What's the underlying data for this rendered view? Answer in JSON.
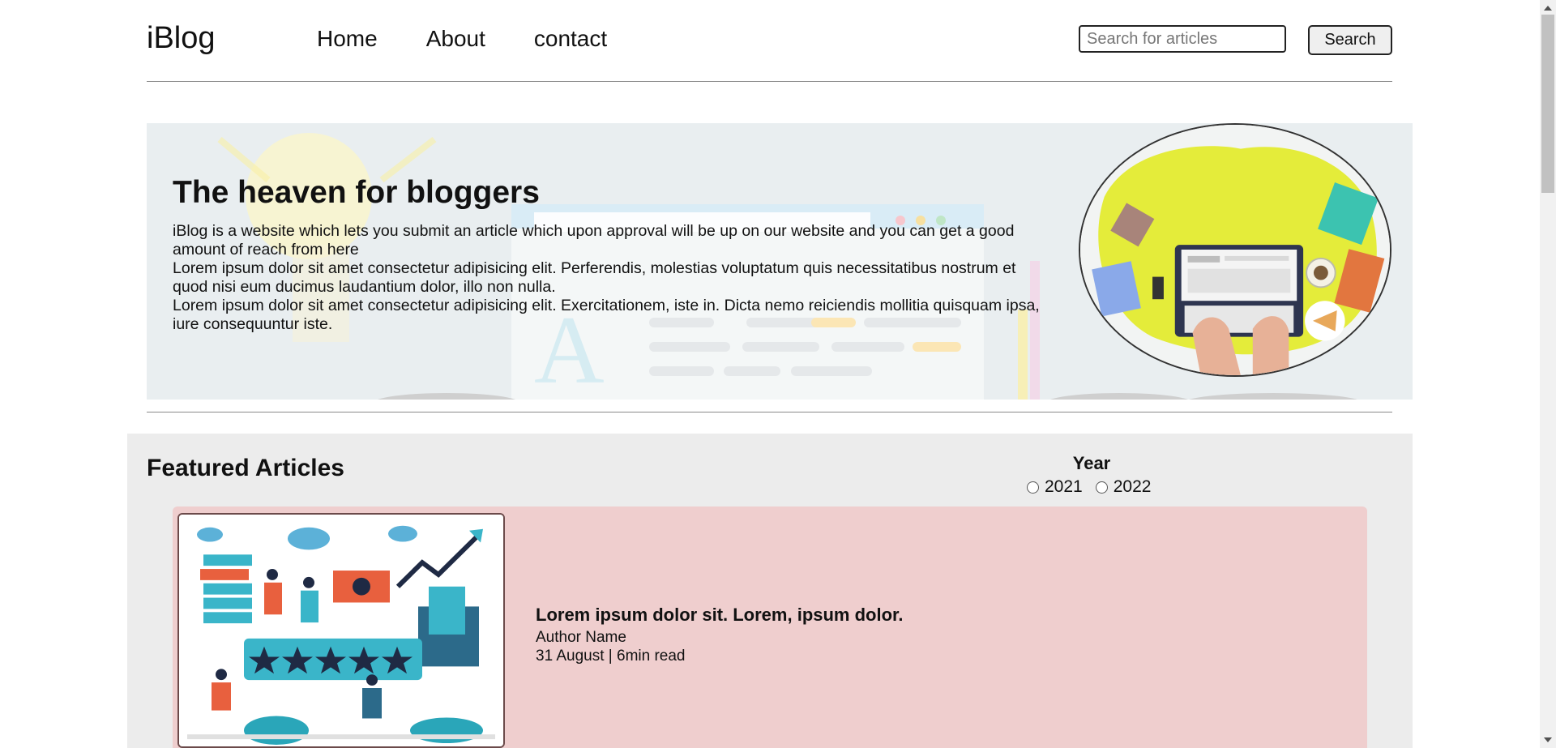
{
  "nav": {
    "logo": "iBlog",
    "links": [
      "Home",
      "About",
      "contact"
    ],
    "search_placeholder": "Search for articles",
    "search_button": "Search"
  },
  "hero": {
    "title": "The heaven for bloggers",
    "paragraphs": [
      "iBlog is a website which lets you submit an article which upon approval will be up on our website and you can get a good amount of reach from here",
      "Lorem ipsum dolor sit amet consectetur adipisicing elit. Perferendis, molestias voluptatum quis necessitatibus nostrum et quod nisi eum ducimus laudantium dolor, illo non nulla.",
      "Lorem ipsum dolor sit amet consectetur adipisicing elit. Exercitationem, iste in. Dicta nemo reiciendis mollitia quisquam ipsa, iure consequuntur iste."
    ],
    "bg_letter": "A"
  },
  "featured": {
    "title": "Featured Articles",
    "year_label": "Year",
    "years": [
      "2021",
      "2022"
    ],
    "article": {
      "title": "Lorem ipsum dolor sit. Lorem, ipsum dolor.",
      "author": "Author Name",
      "meta": "31 August | 6min read"
    }
  },
  "colors": {
    "hero_bg": "#e9eef0",
    "featured_bg": "#ececec",
    "card_bg": "#efcece",
    "circle_yellow": "#e4ec3a",
    "thumb_teal": "#3ab5c9",
    "thumb_orange": "#e8603e"
  },
  "icons": {
    "hero_image": "laptop-desk-illustration",
    "article_image": "marketing-rating-illustration"
  }
}
